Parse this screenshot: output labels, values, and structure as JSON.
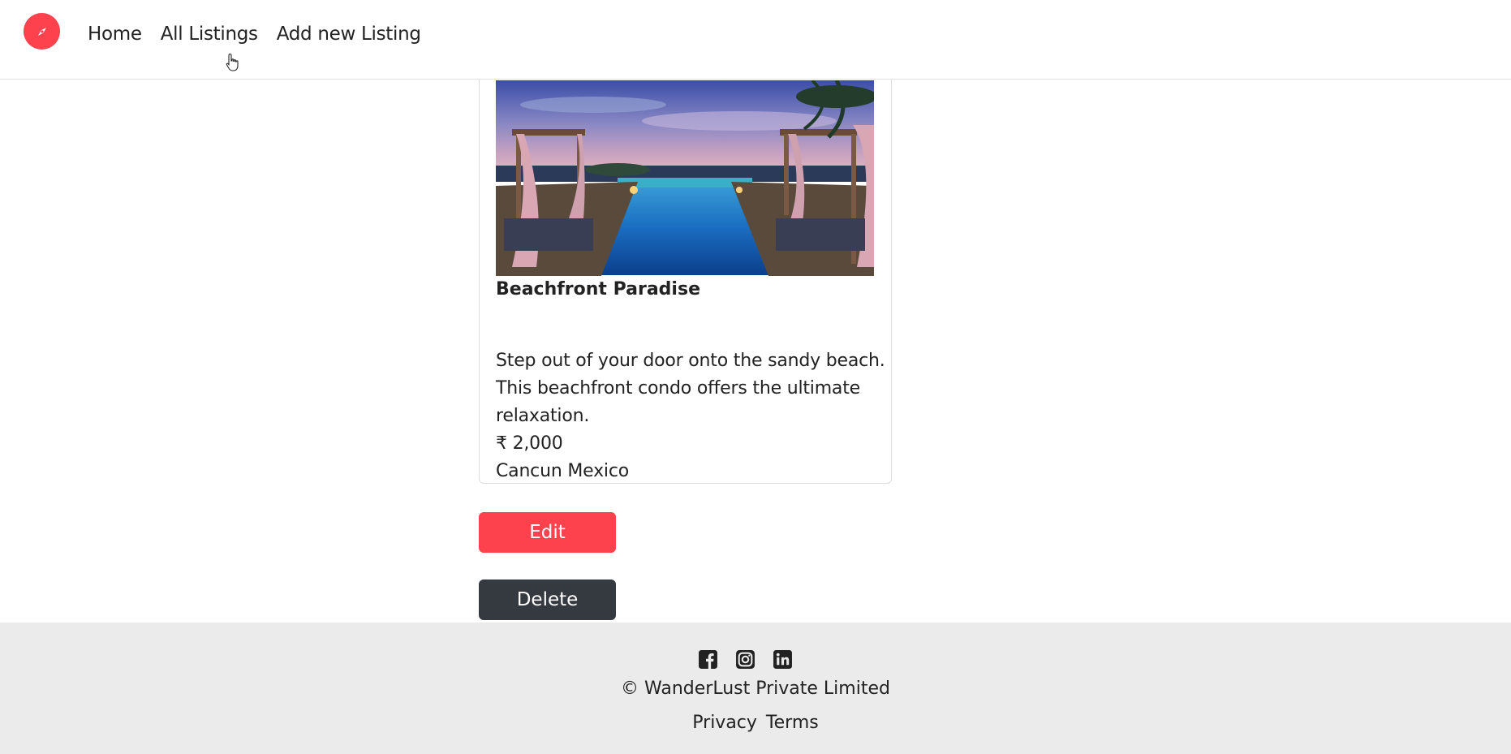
{
  "nav": {
    "logo_icon": "compass-icon",
    "brand_color": "#fe424d",
    "items": [
      {
        "label": "Home"
      },
      {
        "label": "All Listings"
      },
      {
        "label": "Add new Listing"
      }
    ]
  },
  "listing": {
    "image_alt": "Infinity pool with cabanas at dusk",
    "title": "Beachfront Paradise",
    "description_lines": [
      "Step out of your door onto the sandy beach.",
      "This beachfront condo offers the ultimate",
      "relaxation."
    ],
    "price": "₹ 2,000",
    "location": "Cancun Mexico"
  },
  "actions": {
    "edit_label": "Edit",
    "delete_label": "Delete",
    "edit_color": "#fe424d",
    "delete_color": "#343a40"
  },
  "footer": {
    "social_icons": [
      "facebook-icon",
      "instagram-icon",
      "linkedin-icon"
    ],
    "copyright": "© WanderLust Private Limited",
    "links": [
      "Privacy",
      "Terms"
    ]
  }
}
